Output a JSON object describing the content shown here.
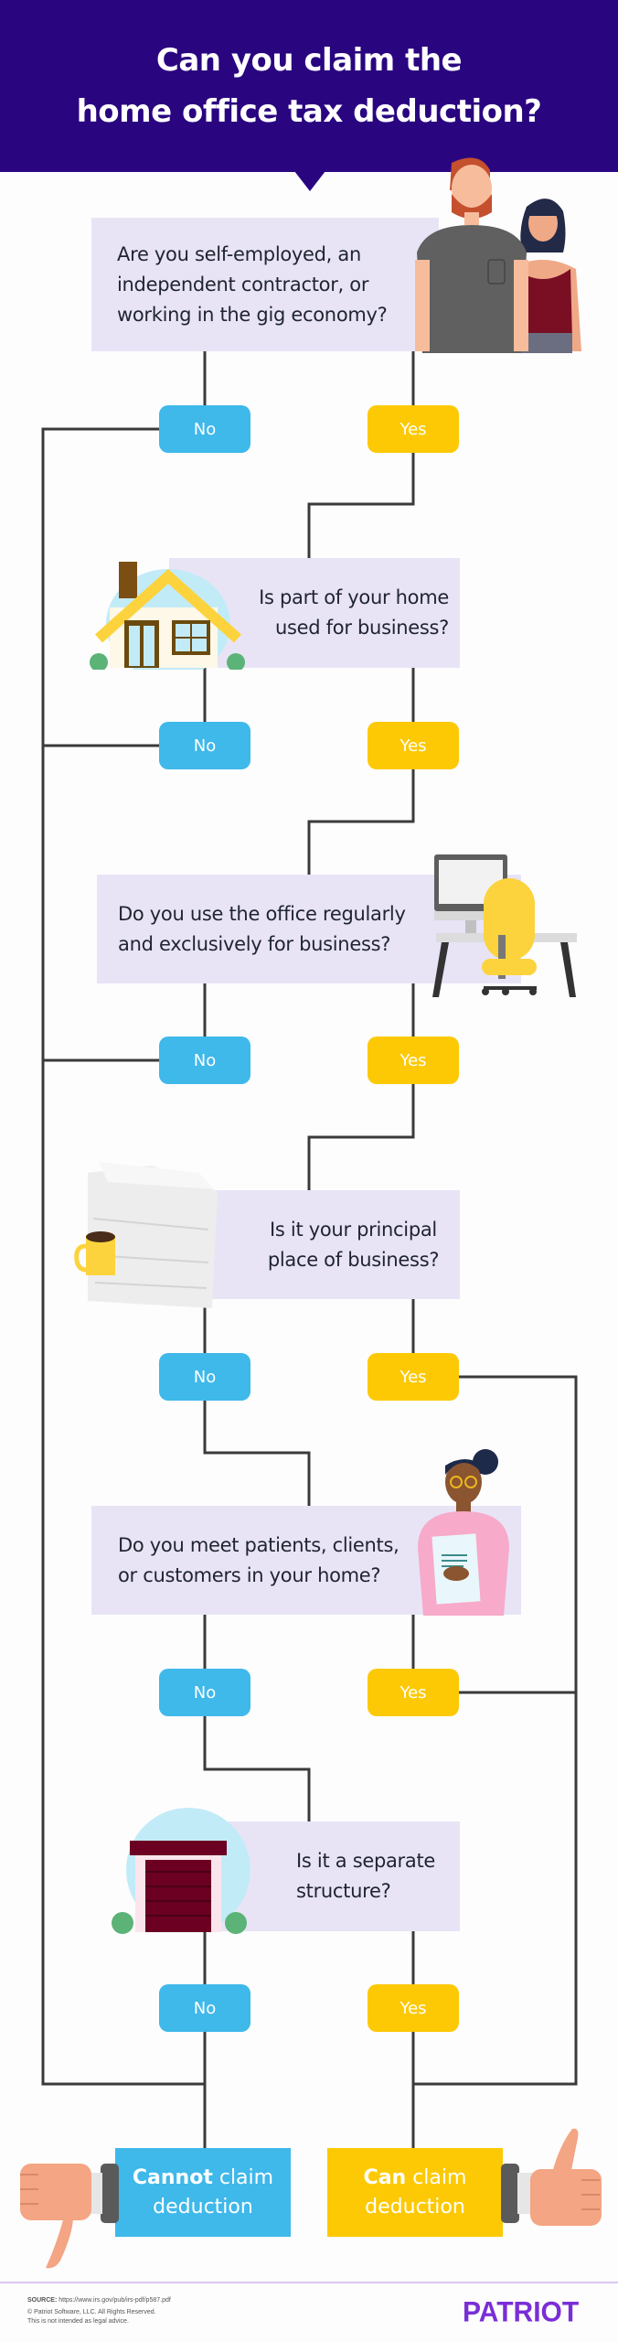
{
  "header": {
    "title_line1": "Can you claim the",
    "title_line2": "home office tax deduction?",
    "background": "#2a0580"
  },
  "questions": [
    {
      "lines": [
        "Are you self-employed, an",
        "independent contractor, or",
        "working in the gig economy?"
      ],
      "illustration": "people-icon"
    },
    {
      "lines": [
        "Is part of your home",
        "used for business?"
      ],
      "illustration": "house-icon"
    },
    {
      "lines": [
        "Do you use the office regularly",
        "and exclusively for business?"
      ],
      "illustration": "desk-chair-icon"
    },
    {
      "lines": [
        "Is it your principal",
        "place of business?"
      ],
      "illustration": "paper-stack-mug-icon"
    },
    {
      "lines": [
        "Do you meet patients, clients,",
        "or customers in your home?"
      ],
      "illustration": "woman-with-document-icon"
    },
    {
      "lines": [
        "Is it a separate",
        "structure?"
      ],
      "illustration": "garage-icon"
    }
  ],
  "answers": {
    "no": "No",
    "yes": "Yes"
  },
  "results": {
    "cannot": {
      "bold": "Cannot",
      "rest": " claim",
      "line2": "deduction",
      "icon": "thumbs-down-icon"
    },
    "can": {
      "bold": "Can",
      "rest": " claim",
      "line2": "deduction",
      "icon": "thumbs-up-icon"
    }
  },
  "colors": {
    "no": "#3fb8ea",
    "yes": "#fdc904",
    "question_bg": "#e8e4f6",
    "connector": "#3a3a3a",
    "brand": "#7a2ed6"
  },
  "footer": {
    "source_label": "SOURCE:",
    "source_url": "https://www.irs.gov/pub/irs-pdf/p587.pdf",
    "copyright": "© Patriot Software, LLC. All Rights Reserved.",
    "disclaimer": "This is not intended as legal advice.",
    "logo": "PATRIOT"
  }
}
